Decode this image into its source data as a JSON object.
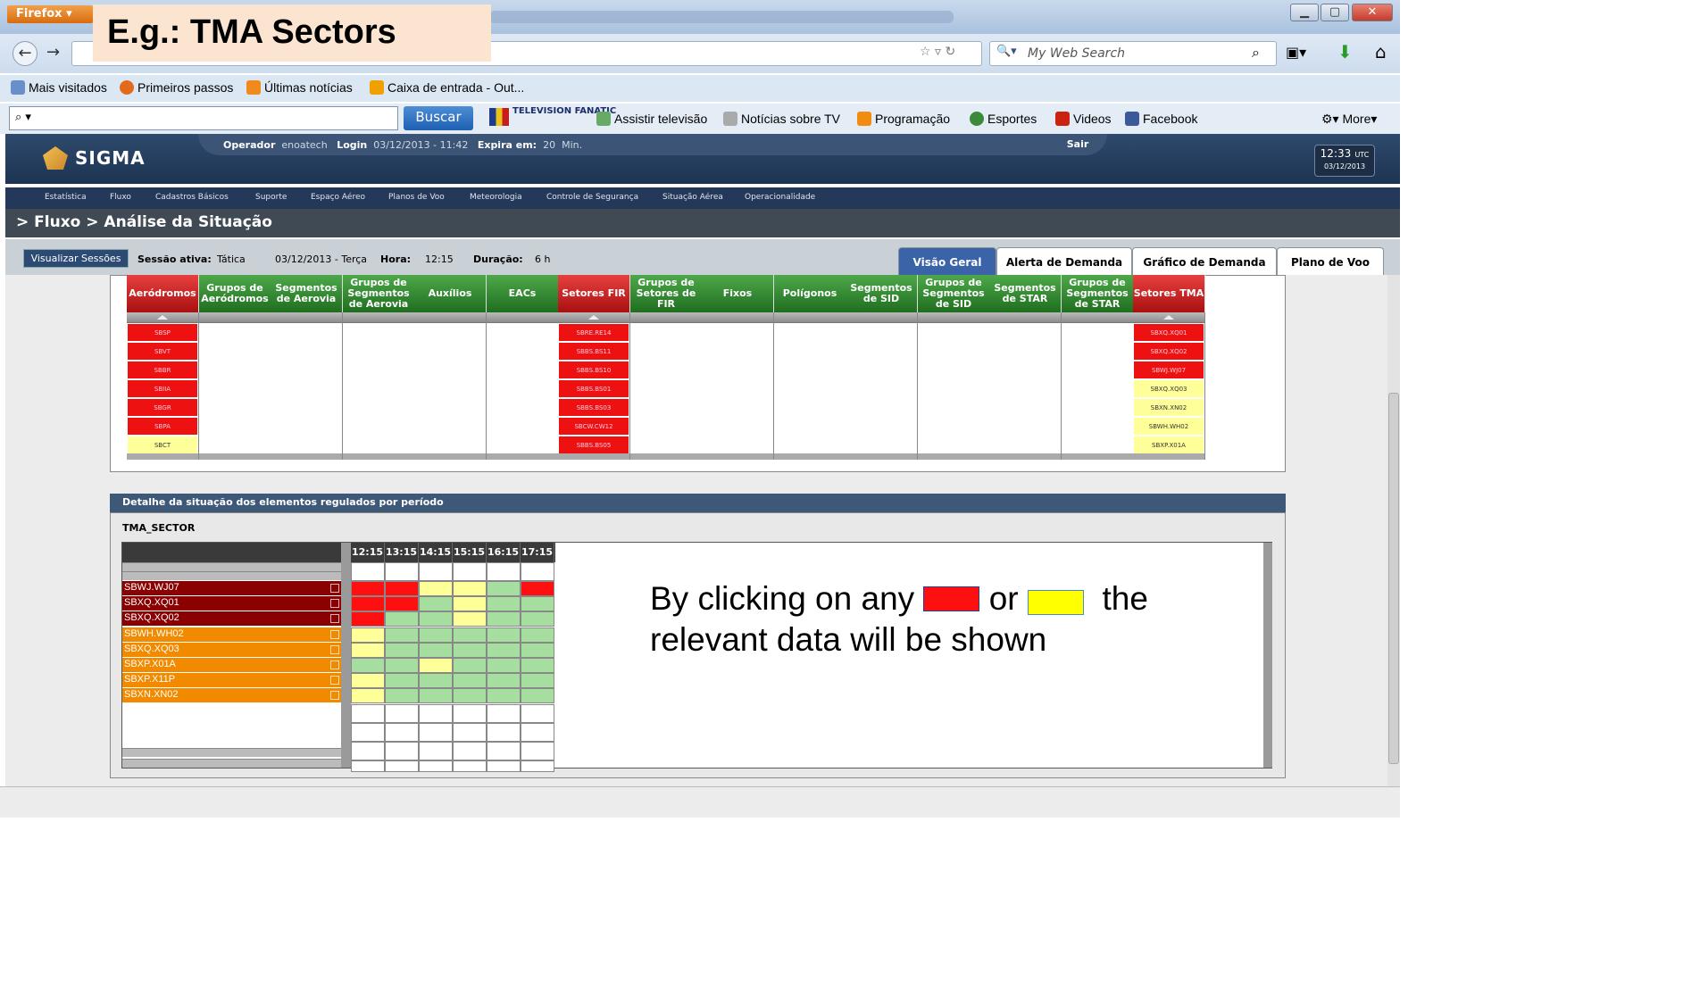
{
  "browser": {
    "menu_label": "Firefox",
    "search_placeholder": "My Web Search",
    "bookmarks": [
      "Mais visitados",
      "Primeiros passos",
      "Últimas notícias",
      "Caixa de entrada - Out..."
    ],
    "toolbar": {
      "search_button": "Buscar",
      "brand": "TELEVISION FANATIC",
      "links": [
        "Assistir televisão",
        "Notícias sobre TV",
        "Programação",
        "Esportes",
        "Videos",
        "Facebook"
      ],
      "more": "More"
    }
  },
  "callout_title": "E.g.: TMA Sectors",
  "app": {
    "logo": "SIGMA",
    "session": {
      "operador_label": "Operador",
      "operador": "enoatech",
      "login_label": "Login",
      "login": "03/12/2013 - 11:42",
      "expira_label": "Expira em:",
      "expira": "20",
      "expira_unit": "Min.",
      "sair": "Sair"
    },
    "clock": {
      "time": "12:33",
      "zone": "UTC",
      "date": "03/12/2013"
    },
    "menu": [
      "Estatística",
      "Fluxo",
      "Cadastros Básicos",
      "Suporte",
      "Espaço Aéreo",
      "Planos de Voo",
      "Meteorologia",
      "Controle de Segurança",
      "Situação Aérea",
      "Operacionalidade"
    ],
    "breadcrumb": "> Fluxo > Análise da Situação",
    "toolbar": {
      "visualizar": "Visualizar Sessões",
      "sessao_label": "Sessão ativa:",
      "sessao": "Tática",
      "data": "03/12/2013 - Terça",
      "hora_label": "Hora:",
      "hora": "12:15",
      "duracao_label": "Duração:",
      "duracao": "6 h"
    },
    "tabs": [
      "Visão Geral",
      "Alerta de Demanda",
      "Gráfico de Demanda",
      "Plano de Voo"
    ]
  },
  "columns": [
    {
      "label": "Aeródromos",
      "color": "red",
      "items": [
        [
          "SBSP",
          "r"
        ],
        [
          "SBVT",
          "r"
        ],
        [
          "SBBR",
          "r"
        ],
        [
          "SBIIA",
          "r"
        ],
        [
          "SBGR",
          "r"
        ],
        [
          "SBPA",
          "r"
        ],
        [
          "SBCT",
          "y"
        ]
      ]
    },
    {
      "label": "Grupos de Aeródromos",
      "color": "green",
      "items": []
    },
    {
      "label": "Segmentos de Aerovia",
      "color": "green",
      "items": []
    },
    {
      "label": "Grupos de Segmentos de Aerovia",
      "color": "green",
      "items": []
    },
    {
      "label": "Auxílios",
      "color": "green",
      "items": []
    },
    {
      "label": "EACs",
      "color": "green",
      "items": []
    },
    {
      "label": "Setores FIR",
      "color": "red",
      "items": [
        [
          "SBRE.RE14",
          "r"
        ],
        [
          "SBBS.BS11",
          "r"
        ],
        [
          "SBBS.BS10",
          "r"
        ],
        [
          "SBBS.BS01",
          "r"
        ],
        [
          "SBBS.BS03",
          "r"
        ],
        [
          "SBCW.CW12",
          "r"
        ],
        [
          "SBBS.BS05",
          "r"
        ]
      ]
    },
    {
      "label": "Grupos de Setores de FIR",
      "color": "green",
      "items": []
    },
    {
      "label": "Fixos",
      "color": "green",
      "items": []
    },
    {
      "label": "Polígonos",
      "color": "green",
      "items": []
    },
    {
      "label": "Segmentos de SID",
      "color": "green",
      "items": []
    },
    {
      "label": "Grupos de Segmentos de SID",
      "color": "green",
      "items": []
    },
    {
      "label": "Segmentos de STAR",
      "color": "green",
      "items": []
    },
    {
      "label": "Grupos de Segmentos de STAR",
      "color": "green",
      "items": []
    },
    {
      "label": "Setores TMA",
      "color": "red",
      "items": [
        [
          "SBXQ.XQ01",
          "r"
        ],
        [
          "SBXQ.XQ02",
          "r"
        ],
        [
          "SBWJ.WJ07",
          "r"
        ],
        [
          "SBXQ.XQ03",
          "y"
        ],
        [
          "SBXN.XN02",
          "y"
        ],
        [
          "SBWH.WH02",
          "y"
        ],
        [
          "SBXP.X01A",
          "y"
        ]
      ]
    }
  ],
  "detail": {
    "header": "Detalhe da situação dos elementos regulados por período",
    "sector_type": "TMA_SECTOR",
    "times": [
      "12:15",
      "13:15",
      "14:15",
      "15:15",
      "16:15",
      "17:15"
    ],
    "rows": [
      {
        "name": "SBWJ.WJ07",
        "tone": "dark",
        "cells": "RRYYGR"
      },
      {
        "name": "SBXQ.XQ01",
        "tone": "dark",
        "cells": "RRGYGG"
      },
      {
        "name": "SBXQ.XQ02",
        "tone": "dark",
        "cells": "RGGYGG"
      },
      {
        "name": "SBWH.WH02",
        "tone": "orange",
        "cells": "YGGGGG"
      },
      {
        "name": "SBXQ.XQ03",
        "tone": "orange",
        "cells": "YGGGGG"
      },
      {
        "name": "SBXP.X01A",
        "tone": "orange",
        "cells": "GGYGGG"
      },
      {
        "name": "SBXP.X11P",
        "tone": "orange",
        "cells": "YGGGGG"
      },
      {
        "name": "SBXN.XN02",
        "tone": "orange",
        "cells": "YGGGGG"
      }
    ]
  },
  "annotation": {
    "part1": "By clicking on any",
    "part2": "or",
    "part3": "the",
    "line2": "relevant data will be shown"
  },
  "colors": {
    "red": "#ee1111",
    "yellow": "#ffff9a",
    "green": "#a6dea0",
    "header": "#2f4a6d"
  }
}
